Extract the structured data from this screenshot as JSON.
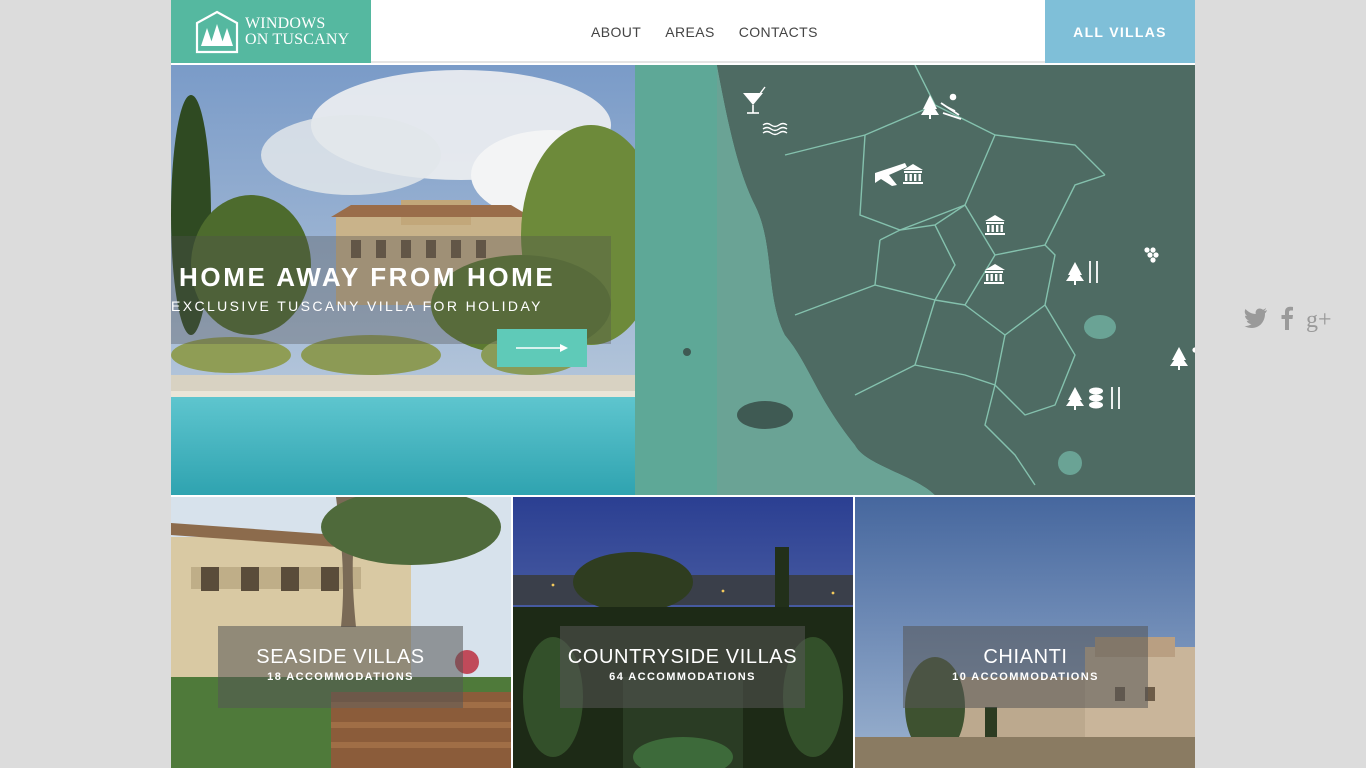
{
  "brand": {
    "logo_line1": "WINDOWS",
    "logo_line2": "ON TUSCANY"
  },
  "nav": {
    "items": [
      "ABOUT",
      "AREAS",
      "CONTACTS"
    ],
    "all_villas": "ALL VILLAS"
  },
  "hero": {
    "title": "HOME AWAY FROM HOME",
    "subtitle": "EXCLUSIVE TUSCANY VILLA FOR HOLIDAY",
    "cta_icon": "arrow-right-icon"
  },
  "social": {
    "icons": [
      "twitter-icon",
      "facebook-icon",
      "google-plus-icon"
    ],
    "google_plus_text": "g+"
  },
  "map": {
    "icons": [
      "cocktail-icon",
      "waves-icon",
      "tree-icon",
      "skiing-icon",
      "airplane-icon",
      "museum-icon",
      "grapes-icon",
      "cutlery-icon",
      "stones-icon"
    ]
  },
  "categories": [
    {
      "title": "SEASIDE VILLAS",
      "count": "18 ACCOMMODATIONS"
    },
    {
      "title": "COUNTRYSIDE VILLAS",
      "count": "64 ACCOMMODATIONS"
    },
    {
      "title": "CHIANTI",
      "count": "10 ACCOMMODATIONS"
    }
  ],
  "colors": {
    "teal": "#55b8a0",
    "sky": "#7fbfd8",
    "map_land": "#4e6b63",
    "map_sea": "#5ea897"
  }
}
